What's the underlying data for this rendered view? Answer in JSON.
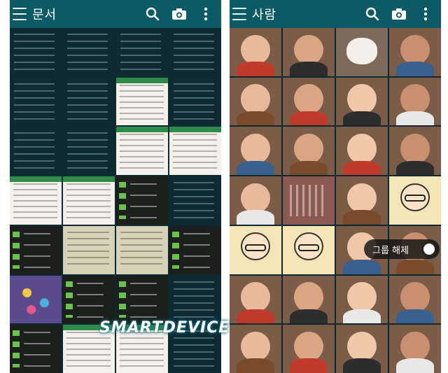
{
  "left_screen": {
    "title": "문서",
    "actions": {
      "search": "search-icon",
      "camera": "camera-icon",
      "overflow": "overflow-menu-icon"
    },
    "thumbnails": [
      "doc-dark",
      "doc-dark",
      "doc-dark",
      "doc-dark",
      "doc-dark",
      "doc-dark",
      "doc-light",
      "doc-dark",
      "doc-dark",
      "doc-dark",
      "doc-light",
      "doc-light",
      "doc-light",
      "doc-light",
      "doc-list",
      "doc-dark",
      "doc-list",
      "doc-beige",
      "doc-beige",
      "doc-list",
      "doc-purple",
      "doc-list",
      "doc-list",
      "doc-dark",
      "doc-list",
      "doc-light",
      "doc-light",
      "doc-dark"
    ]
  },
  "right_screen": {
    "title": "사람",
    "actions": {
      "search": "search-icon",
      "camera": "camera-icon",
      "overflow": "overflow-menu-icon"
    },
    "thumbnails": [
      "face",
      "face",
      "dog",
      "face",
      "face",
      "face",
      "face",
      "face",
      "face",
      "face",
      "face",
      "face",
      "face",
      "notebook",
      "face",
      "cartoon",
      "cartoon",
      "cartoon",
      "face",
      "face",
      "face",
      "face",
      "face",
      "face",
      "face",
      "face",
      "face",
      "face"
    ],
    "ungroup_button": "그룹 해제",
    "watermark": "SMARTDEVICE"
  },
  "colors": {
    "app_bar": "#0b5a66",
    "accent": "#6cc14c"
  }
}
